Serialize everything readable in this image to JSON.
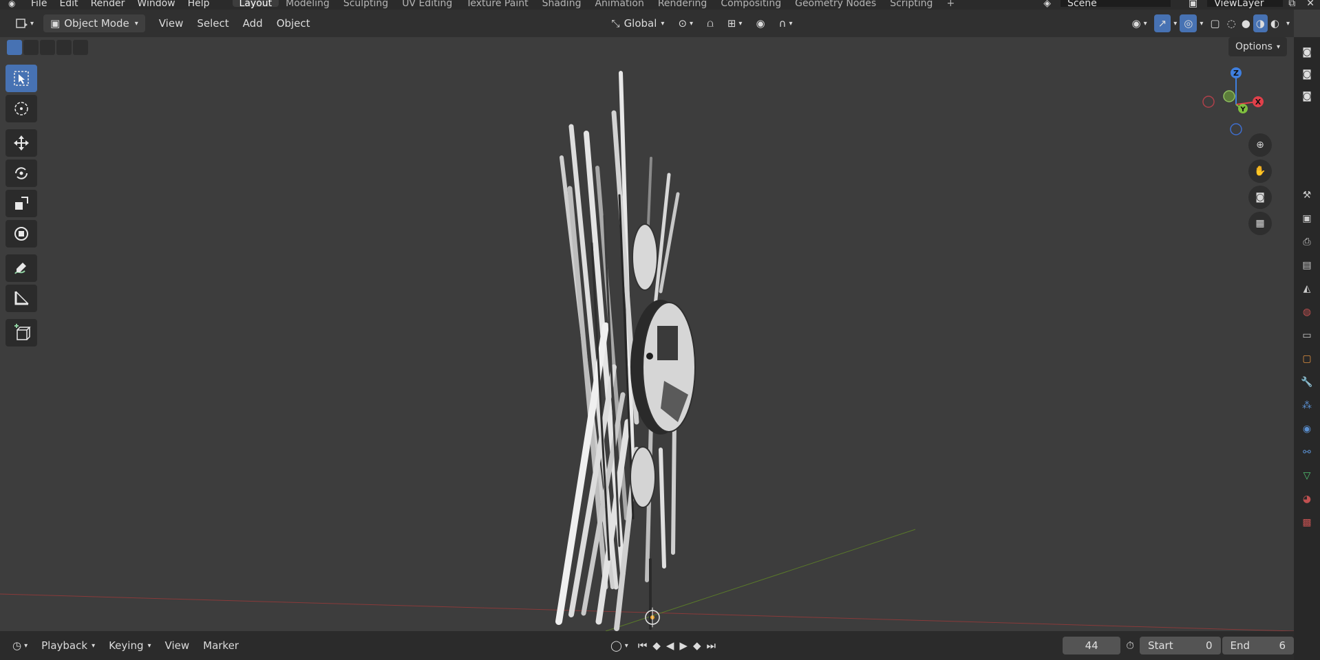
{
  "menu": {
    "items": [
      "File",
      "Edit",
      "Render",
      "Window",
      "Help"
    ]
  },
  "workspaces": {
    "tabs": [
      "Layout",
      "Modeling",
      "Sculpting",
      "UV Editing",
      "Texture Paint",
      "Shading",
      "Animation",
      "Rendering",
      "Compositing",
      "Geometry Nodes",
      "Scripting"
    ],
    "active": "Layout"
  },
  "scene": {
    "name": "Scene",
    "view_layer": "ViewLayer"
  },
  "header": {
    "mode": "Object Mode",
    "view": "View",
    "select": "Select",
    "add": "Add",
    "object": "Object",
    "orientation": "Global"
  },
  "viewport": {
    "options": "Options"
  },
  "gizmo": {
    "z": "Z",
    "y": "Y",
    "x": "X"
  },
  "timeline": {
    "playback": "Playback",
    "keying": "Keying",
    "view": "View",
    "marker": "Marker",
    "current_frame": "44",
    "start_label": "Start",
    "start_value": "0",
    "end_label": "End",
    "end_value": "6"
  },
  "colors": {
    "accent": "#4772b3",
    "axis_x": "#e0404a",
    "axis_y": "#7fbf3f",
    "axis_z": "#3f7fdf"
  }
}
